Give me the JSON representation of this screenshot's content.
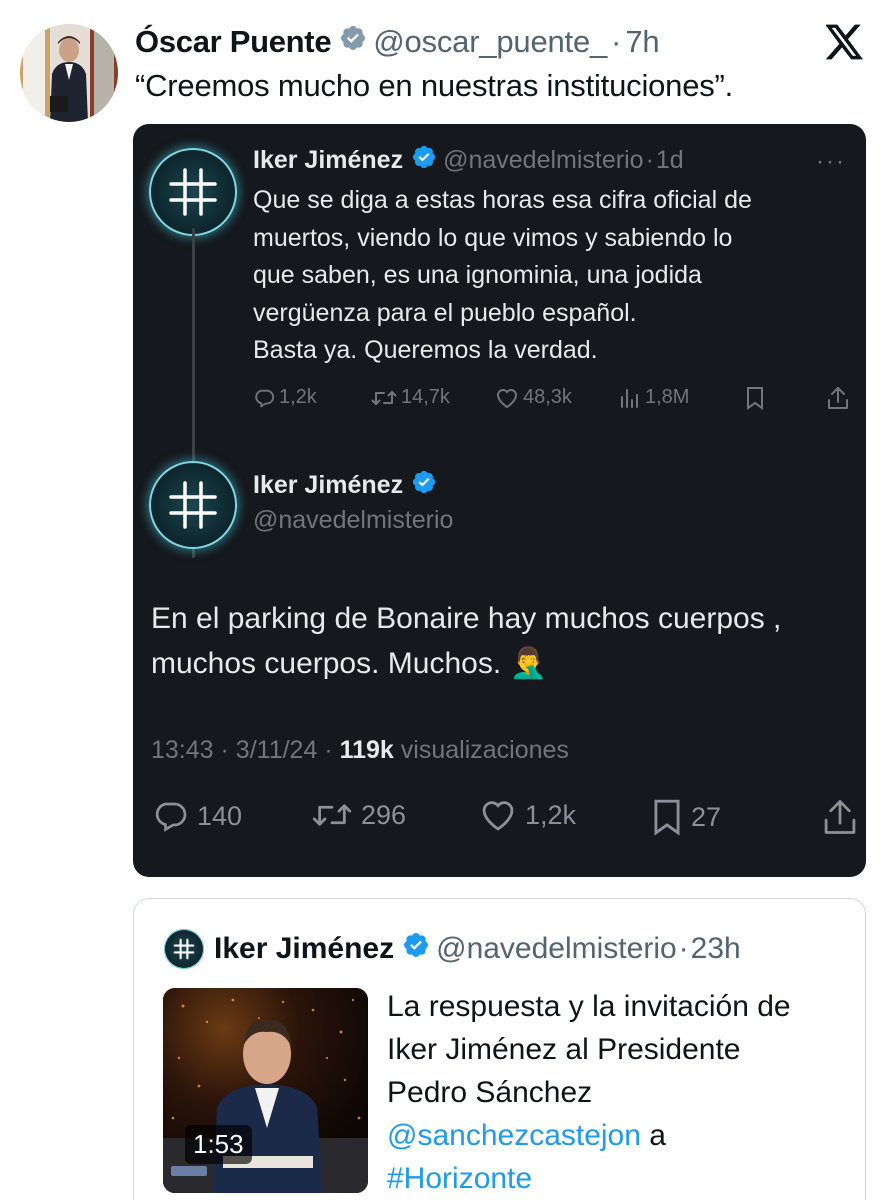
{
  "top_tweet": {
    "name": "Óscar Puente",
    "handle": "@oscar_puente_",
    "separator": "·",
    "time": "7h",
    "text": "“Creemos mucho en nuestras instituciones”."
  },
  "thread": {
    "first": {
      "name": "Iker Jiménez",
      "handle": "@navedelmisterio",
      "separator": "·",
      "time": "1d",
      "more": "···",
      "lines": [
        "Que se diga a estas horas esa cifra oficial de",
        "muertos, viendo lo que vimos y sabiendo lo",
        "que saben, es una ignominia, una jodida",
        "vergüenza para el pueblo español.",
        "Basta ya. Queremos la verdad."
      ],
      "actions": {
        "replies": "1,2k",
        "reposts": "14,7k",
        "likes": "48,3k",
        "views": "1,8M"
      }
    },
    "second": {
      "name": "Iker Jiménez",
      "handle": "@navedelmisterio",
      "lines": [
        "En el parking de Bonaire hay muchos cuerpos ,",
        "muchos cuerpos. Muchos."
      ],
      "emoji": "🤦‍♂️",
      "time": "13:43",
      "sep1": "·",
      "date": "3/11/24",
      "sep2": "·",
      "views_count": "119k",
      "views_label": "visualizaciones",
      "actions": {
        "replies": "140",
        "reposts": "296",
        "likes": "1,2k",
        "bookmarks": "27"
      }
    }
  },
  "quoted": {
    "name": "Iker Jiménez",
    "handle": "@navedelmisterio",
    "separator": "·",
    "time": "23h",
    "video_duration": "1:53",
    "lines": [
      "La respuesta y la invitación de",
      "Iker Jiménez al Presidente",
      "Pedro Sánchez"
    ],
    "mention": "@sanchezcastejon",
    "mention_suffix": " a",
    "hashtag": "#Horizonte"
  },
  "colors": {
    "verified": "#1d9bf0",
    "dark_bg": "#15181c",
    "link": "#1d9bf0",
    "glow": "#7fd8e6"
  },
  "icons": [
    "verified-badge-icon",
    "x-logo-icon",
    "more-icon",
    "reply-icon",
    "repost-icon",
    "like-icon",
    "views-icon",
    "bookmark-icon",
    "share-icon"
  ]
}
